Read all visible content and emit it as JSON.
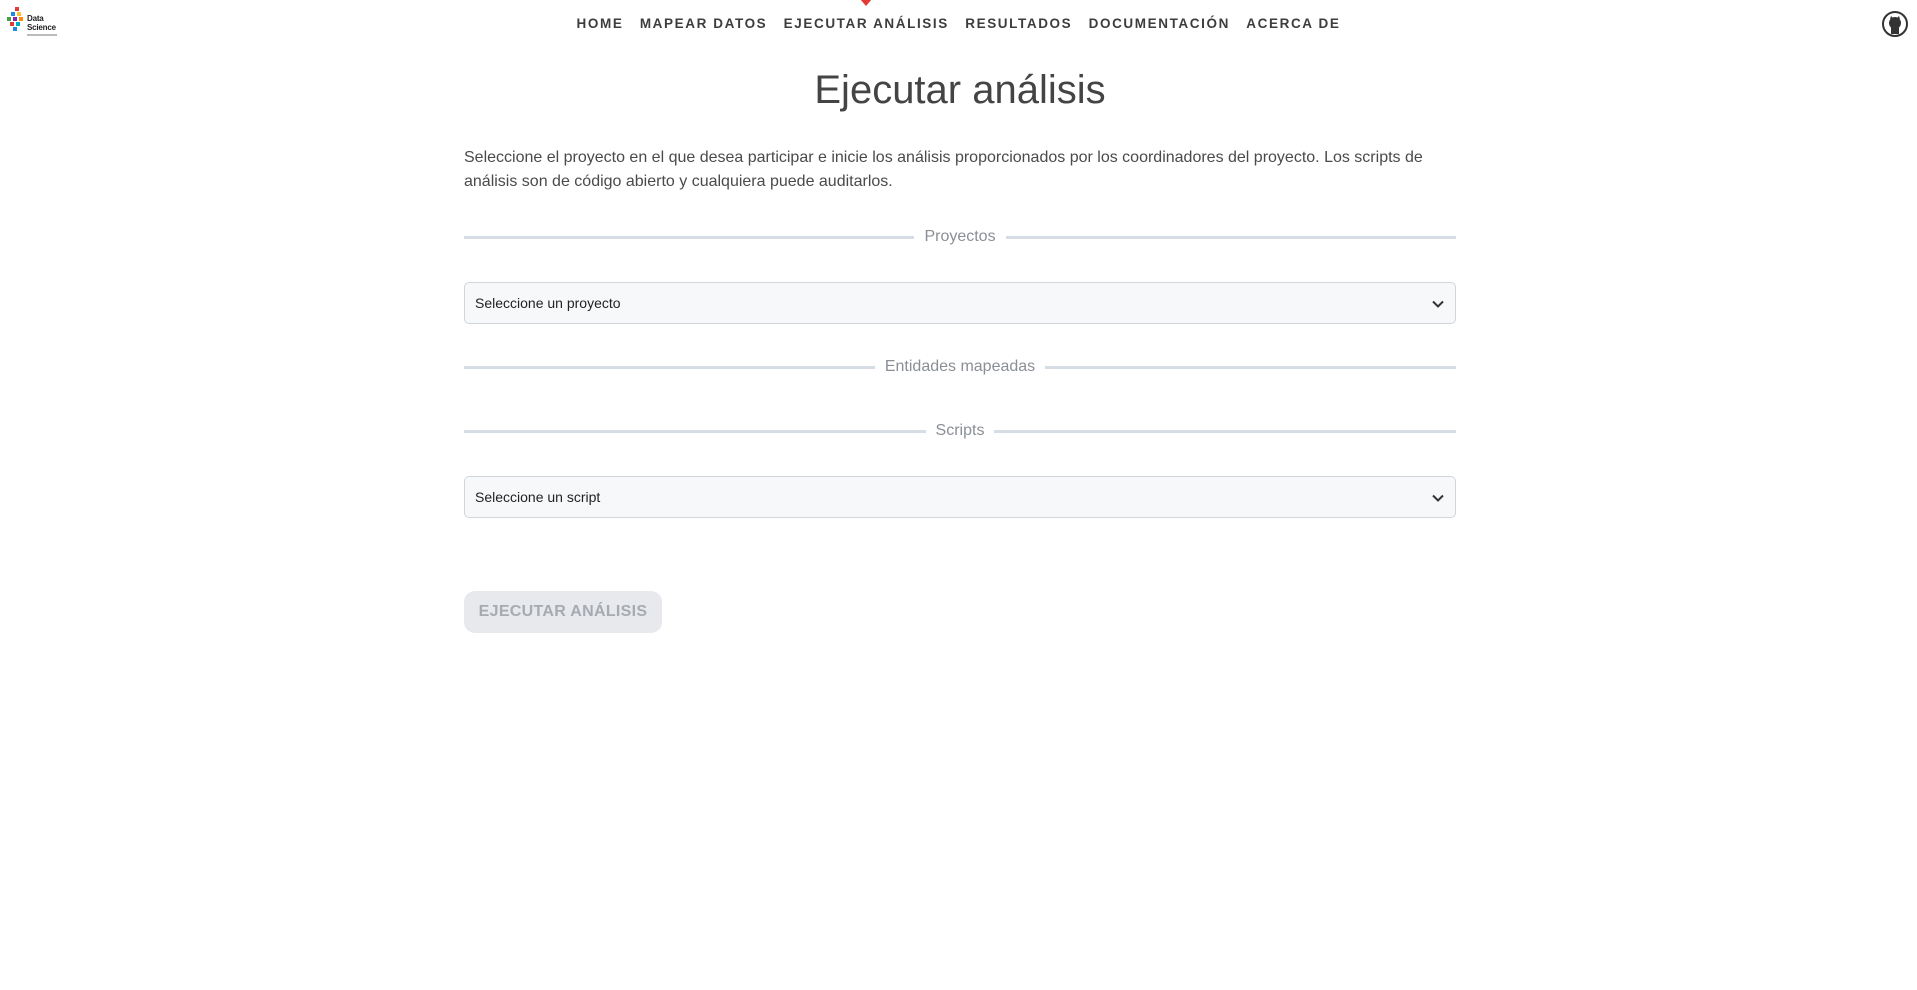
{
  "logo": {
    "text_line1": "Data",
    "text_line2": "Science"
  },
  "nav": {
    "items": [
      {
        "label": "HOME"
      },
      {
        "label": "MAPEAR DATOS"
      },
      {
        "label": "EJECUTAR ANÁLISIS",
        "active": true
      },
      {
        "label": "RESULTADOS"
      },
      {
        "label": "DOCUMENTACIÓN"
      },
      {
        "label": "ACERCA DE"
      }
    ],
    "active_color": "#e53935"
  },
  "page": {
    "title": "Ejecutar análisis",
    "intro": "Seleccione el proyecto en el que desea participar e inicie los análisis proporcionados por los coordinadores del proyecto. Los scripts de análisis son de código abierto y cualquiera puede auditarlos."
  },
  "sections": {
    "projects": "Proyectos",
    "entities": "Entidades mapeadas",
    "scripts": "Scripts"
  },
  "project_select": {
    "value": "Seleccione un proyecto"
  },
  "script_select": {
    "value": "Seleccione un script"
  },
  "run_button": {
    "label": "EJECUTAR ANÁLISIS",
    "disabled": true
  }
}
